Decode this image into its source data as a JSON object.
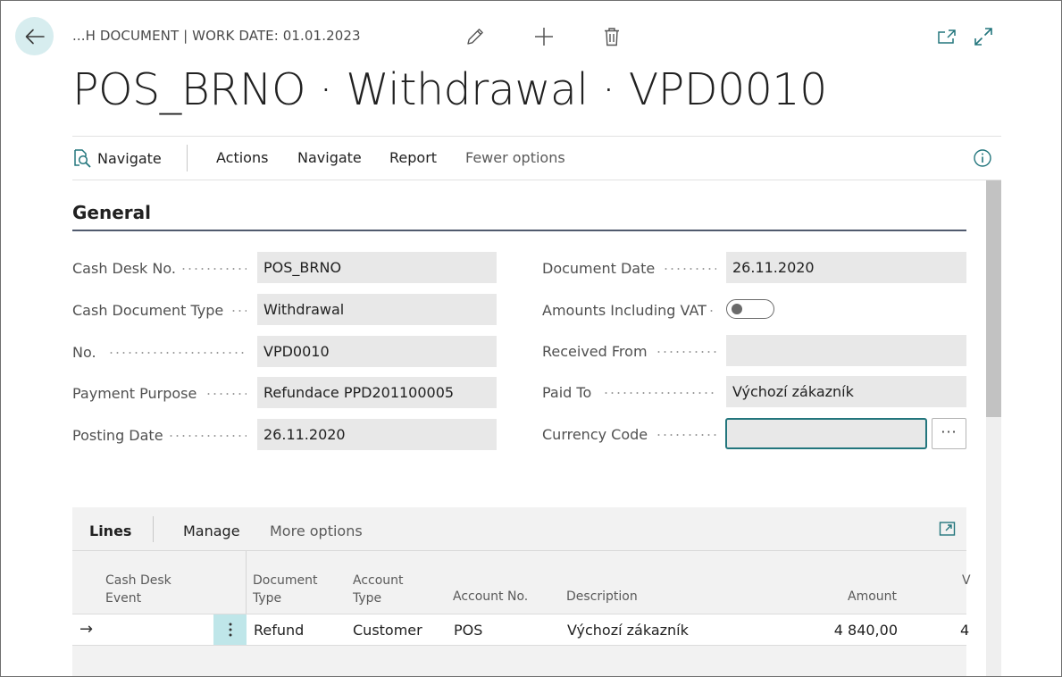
{
  "header": {
    "caption": "...H DOCUMENT | WORK DATE: 01.01.2023",
    "title": "POS_BRNO · Withdrawal · VPD0010"
  },
  "toolbar_icons": {
    "edit": "pencil-icon",
    "new": "plus-icon",
    "delete": "trash-icon",
    "open_new_window": "open-in-new-window-icon",
    "expand": "expand-icon"
  },
  "action_bar": {
    "navigate_primary": "Navigate",
    "actions": "Actions",
    "navigate": "Navigate",
    "report": "Report",
    "fewer_options": "Fewer options"
  },
  "general": {
    "section_title": "General",
    "left_fields": [
      {
        "label": "Cash Desk No.",
        "value": "POS_BRNO"
      },
      {
        "label": "Cash Document Type",
        "value": "Withdrawal"
      },
      {
        "label": "No.",
        "value": "VPD0010"
      },
      {
        "label": "Payment Purpose",
        "value": "Refundace PPD201100005"
      },
      {
        "label": "Posting Date",
        "value": "26.11.2020"
      }
    ],
    "right_fields": [
      {
        "label": "Document Date",
        "value": "26.11.2020"
      },
      {
        "label": "Amounts Including VAT",
        "value": "off"
      },
      {
        "label": "Received From",
        "value": ""
      },
      {
        "label": "Paid To",
        "value": "Výchozí zákazník"
      },
      {
        "label": "Currency Code",
        "value": ""
      }
    ],
    "lookup_label": "···"
  },
  "lines": {
    "tabs": {
      "lines": "Lines",
      "manage": "Manage",
      "more_options": "More options"
    },
    "columns": {
      "cash_desk_event_1": "Cash Desk",
      "cash_desk_event_2": "Event",
      "document_type_1": "Document",
      "document_type_2": "Type",
      "account_type_1": "Account",
      "account_type_2": "Type",
      "account_no": "Account No.",
      "description": "Description",
      "amount": "Amount",
      "truncated": "V"
    },
    "rows": [
      {
        "indicator": "→",
        "cash_desk_event": "",
        "document_type": "Refund",
        "account_type": "Customer",
        "account_no": "POS",
        "description": "Výchozí zákazník",
        "amount": "4 840,00",
        "truncated": "4"
      }
    ]
  },
  "colors": {
    "accent": "#23767d",
    "back_button_bg": "#d7edef",
    "row_menu_bg": "#bfe6e9",
    "field_bg": "#e8e8e8",
    "section_rule": "#505a6e"
  }
}
